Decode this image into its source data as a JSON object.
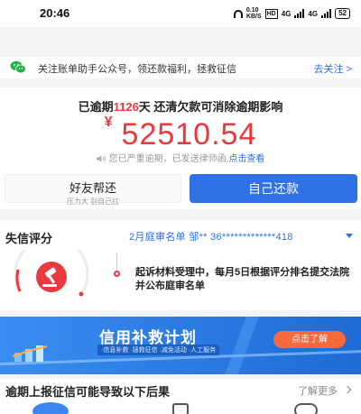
{
  "status_bar": {
    "time": "20:46",
    "net_speed_top": "0.10",
    "net_speed_unit": "KB/S",
    "hd": "HD",
    "signal_1": "4G",
    "signal_2": "4G",
    "battery": "52"
  },
  "notice": {
    "text": "关注账单助手公众号，领还款福利，拯救征信",
    "link": "去关注 >"
  },
  "overdue": {
    "prefix": "已逾期",
    "days": "1126",
    "suffix": "天 还清欠款可消除逾期影响",
    "currency": "¥",
    "amount": "52510.54",
    "legal_text": "您已严重逾期，已发送律师函,",
    "legal_link": "点击查看"
  },
  "buttons": {
    "friend_main": "好友帮还",
    "friend_sub": "压力大 别自己扛",
    "self": "自己还款"
  },
  "credit": {
    "title": "失信评分",
    "court_notice": "2月庭审名单 邹** 36*************418",
    "description": "起诉材料受理中，每月5日根据评分排名提交法院并公布庭审名单"
  },
  "banner": {
    "title": "信用补救计划",
    "subtitle": "·信息补救 ·拯救征信 ·减免活动 ·人工服务",
    "button": "点击了解"
  },
  "consequences": {
    "title": "逾期上报征信可能导致以下后果",
    "more": "了解更多"
  },
  "colors": {
    "accent_red": "#e8393f",
    "accent_blue": "#2e72e6",
    "wechat_green": "#2bb24c",
    "banner_orange": "#f86a3e"
  },
  "icons": [
    "wechat-icon",
    "speaker-icon",
    "gavel-icon",
    "chevron-down-icon",
    "chevron-right-icon",
    "user-tab-icon",
    "money-tab-icon",
    "chat-tab-icon"
  ]
}
